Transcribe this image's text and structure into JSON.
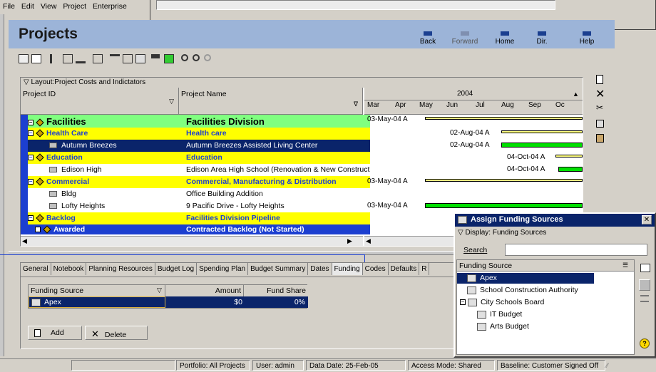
{
  "menu": [
    "File",
    "Edit",
    "View",
    "Project",
    "Enterprise"
  ],
  "header": {
    "title": "Projects"
  },
  "nav": {
    "back": "Back",
    "forward": "Forward",
    "home": "Home",
    "dir": "Dir.",
    "help": "Help"
  },
  "layout_label": "Layout:Project Costs and Indictators",
  "columns": {
    "project_id": "Project ID",
    "project_name": "Project Name"
  },
  "gantt": {
    "year": "2004",
    "months": [
      "Mar",
      "Apr",
      "May",
      "Jun",
      "Jul",
      "Aug",
      "Sep",
      "Oc"
    ],
    "labels": [
      "03-May-04 A",
      "02-Aug-04 A",
      "02-Aug-04 A",
      "04-Oct-04 A",
      "04-Oct-04 A",
      "03-May-04 A",
      "03-May-04 A"
    ]
  },
  "rows": [
    {
      "id": "Facilities",
      "name": "Facilities Division"
    },
    {
      "id": "Health Care",
      "name": "Health care"
    },
    {
      "id": "Autumn Breezes",
      "name": "Autumn Breezes Assisted Living Center"
    },
    {
      "id": "Education",
      "name": "Education"
    },
    {
      "id": "Edison High",
      "name": "Edison Area High School (Renovation & New Construct"
    },
    {
      "id": "Commercial",
      "name": "Commercial, Manufacturing & Distribution"
    },
    {
      "id": "Bldg",
      "name": "Office Building Addition"
    },
    {
      "id": "Lofty Heights",
      "name": "9 Pacific Drive - Lofty Heights"
    },
    {
      "id": "Backlog",
      "name": "Facilities Division Pipeline"
    },
    {
      "id": "Awarded",
      "name": "Contracted Backlog (Not Started)"
    }
  ],
  "tabs": [
    "General",
    "Notebook",
    "Planning Resources",
    "Budget Log",
    "Spending Plan",
    "Budget Summary",
    "Dates",
    "Funding",
    "Codes",
    "Defaults",
    "R"
  ],
  "funding_table": {
    "headers": [
      "Funding Source",
      "Amount",
      "Fund Share"
    ],
    "row": {
      "source": "Apex",
      "amount": "$0",
      "share": "0%"
    },
    "add": "Add",
    "delete": "Delete"
  },
  "dialog": {
    "title": "Assign Funding Sources",
    "display": "Display: Funding Sources",
    "search_label": "Search",
    "search_value": "",
    "column": "Funding Source",
    "items": [
      "Apex",
      "School Construction Authority",
      "City Schools Board",
      "IT Budget",
      "Arts Budget"
    ]
  },
  "status": {
    "portfolio": "Portfolio: All Projects",
    "user": "User: admin",
    "data_date": "Data Date: 25-Feb-05",
    "access": "Access Mode: Shared",
    "baseline": "Baseline: Customer Signed Off"
  },
  "colors": {
    "header_bg": "#9cb4d8",
    "green_row": "#80ff80",
    "yellow_row": "#ffff00",
    "selected": "#0a246a",
    "dialog_title": "#0a246a",
    "gantt_bar": "#00e000"
  }
}
